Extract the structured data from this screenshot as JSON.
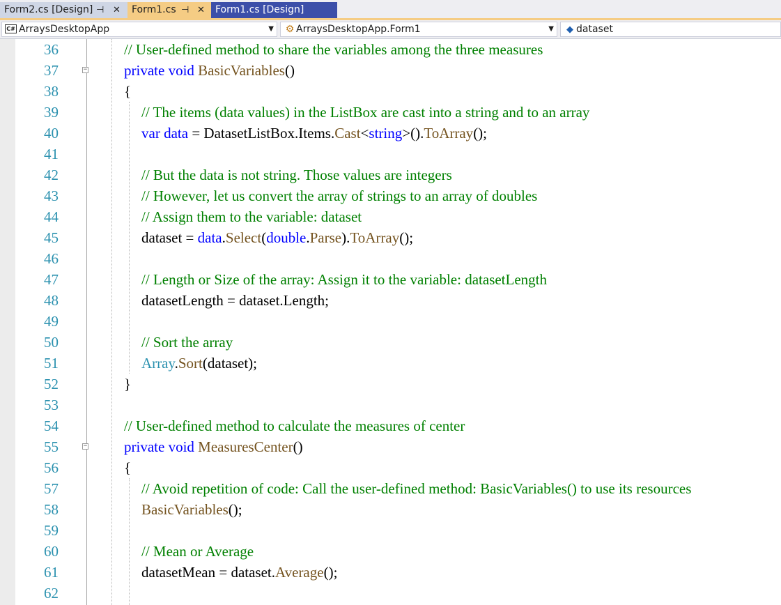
{
  "tabs": [
    {
      "label": "Form2.cs [Design]",
      "pinned": true,
      "closable": true
    },
    {
      "label": "Form1.cs",
      "pinned": true,
      "closable": true,
      "active": true
    },
    {
      "label": "Form1.cs [Design]"
    }
  ],
  "nav": {
    "project": "ArraysDesktopApp",
    "class": "ArraysDesktopApp.Form1",
    "member": "dataset",
    "project_icon": "csharp-icon",
    "class_icon": "class-icon",
    "member_icon": "field-icon"
  },
  "colors": {
    "comment": "#008000",
    "keyword": "#0000ff",
    "method": "#74531f",
    "type": "#2b91af",
    "line_number": "#2b91af",
    "active_tab": "#f5cc84"
  },
  "lines": [
    {
      "num": "36",
      "indent": 1,
      "tokens": [
        {
          "t": "// User-defined method to share the variables among the three measures",
          "c": "cm"
        }
      ]
    },
    {
      "num": "37",
      "indent": 1,
      "tokens": [
        {
          "t": "private",
          "c": "kw"
        },
        {
          "t": " ",
          "c": "pl"
        },
        {
          "t": "void",
          "c": "kw"
        },
        {
          "t": " ",
          "c": "pl"
        },
        {
          "t": "BasicVariables",
          "c": "mt"
        },
        {
          "t": "()",
          "c": "pl"
        }
      ]
    },
    {
      "num": "38",
      "indent": 1,
      "tokens": [
        {
          "t": "{",
          "c": "pl"
        }
      ]
    },
    {
      "num": "39",
      "indent": 2,
      "tokens": [
        {
          "t": "// The items (data values) in the ListBox are cast into a string and to an array",
          "c": "cm"
        }
      ]
    },
    {
      "num": "40",
      "indent": 2,
      "tokens": [
        {
          "t": "var",
          "c": "kw"
        },
        {
          "t": " ",
          "c": "pl"
        },
        {
          "t": "data",
          "c": "kw"
        },
        {
          "t": " = DatasetListBox.Items.",
          "c": "pl"
        },
        {
          "t": "Cast",
          "c": "mt"
        },
        {
          "t": "<",
          "c": "pl"
        },
        {
          "t": "string",
          "c": "kw"
        },
        {
          "t": ">().",
          "c": "pl"
        },
        {
          "t": "ToArray",
          "c": "mt"
        },
        {
          "t": "();",
          "c": "pl"
        }
      ]
    },
    {
      "num": "41",
      "indent": 2,
      "tokens": []
    },
    {
      "num": "42",
      "indent": 2,
      "tokens": [
        {
          "t": "// But the data is not string. Those values are integers",
          "c": "cm"
        }
      ]
    },
    {
      "num": "43",
      "indent": 2,
      "tokens": [
        {
          "t": "// However, let us convert the array of strings to an array of doubles",
          "c": "cm"
        }
      ]
    },
    {
      "num": "44",
      "indent": 2,
      "tokens": [
        {
          "t": "// Assign them to the variable: dataset",
          "c": "cm"
        }
      ]
    },
    {
      "num": "45",
      "indent": 2,
      "tokens": [
        {
          "t": "dataset = ",
          "c": "pl"
        },
        {
          "t": "data",
          "c": "kw"
        },
        {
          "t": ".",
          "c": "pl"
        },
        {
          "t": "Select",
          "c": "mt"
        },
        {
          "t": "(",
          "c": "pl"
        },
        {
          "t": "double",
          "c": "kw"
        },
        {
          "t": ".",
          "c": "pl"
        },
        {
          "t": "Parse",
          "c": "mt"
        },
        {
          "t": ").",
          "c": "pl"
        },
        {
          "t": "ToArray",
          "c": "mt"
        },
        {
          "t": "();",
          "c": "pl"
        }
      ]
    },
    {
      "num": "46",
      "indent": 2,
      "tokens": []
    },
    {
      "num": "47",
      "indent": 2,
      "tokens": [
        {
          "t": "// Length or Size of the array: Assign it to the variable: datasetLength",
          "c": "cm"
        }
      ]
    },
    {
      "num": "48",
      "indent": 2,
      "tokens": [
        {
          "t": "datasetLength = dataset.Length;",
          "c": "pl"
        }
      ]
    },
    {
      "num": "49",
      "indent": 2,
      "tokens": []
    },
    {
      "num": "50",
      "indent": 2,
      "tokens": [
        {
          "t": "// Sort the array",
          "c": "cm"
        }
      ]
    },
    {
      "num": "51",
      "indent": 2,
      "tokens": [
        {
          "t": "Array",
          "c": "ty"
        },
        {
          "t": ".",
          "c": "pl"
        },
        {
          "t": "Sort",
          "c": "mt"
        },
        {
          "t": "(dataset);",
          "c": "pl"
        }
      ]
    },
    {
      "num": "52",
      "indent": 1,
      "tokens": [
        {
          "t": "}",
          "c": "pl"
        }
      ]
    },
    {
      "num": "53",
      "indent": 1,
      "tokens": []
    },
    {
      "num": "54",
      "indent": 1,
      "tokens": [
        {
          "t": "// User-defined method to calculate the measures of center",
          "c": "cm"
        }
      ]
    },
    {
      "num": "55",
      "indent": 1,
      "tokens": [
        {
          "t": "private",
          "c": "kw"
        },
        {
          "t": " ",
          "c": "pl"
        },
        {
          "t": "void",
          "c": "kw"
        },
        {
          "t": " ",
          "c": "pl"
        },
        {
          "t": "MeasuresCenter",
          "c": "mt"
        },
        {
          "t": "()",
          "c": "pl"
        }
      ]
    },
    {
      "num": "56",
      "indent": 1,
      "tokens": [
        {
          "t": "{",
          "c": "pl"
        }
      ]
    },
    {
      "num": "57",
      "indent": 2,
      "tokens": [
        {
          "t": "// Avoid repetition of code: Call the user-defined method: BasicVariables() to use its resources",
          "c": "cm"
        }
      ]
    },
    {
      "num": "58",
      "indent": 2,
      "tokens": [
        {
          "t": "BasicVariables",
          "c": "mt"
        },
        {
          "t": "();",
          "c": "pl"
        }
      ]
    },
    {
      "num": "59",
      "indent": 2,
      "tokens": []
    },
    {
      "num": "60",
      "indent": 2,
      "tokens": [
        {
          "t": "// Mean or Average",
          "c": "cm"
        }
      ]
    },
    {
      "num": "61",
      "indent": 2,
      "tokens": [
        {
          "t": "datasetMean = dataset.",
          "c": "pl"
        },
        {
          "t": "Average",
          "c": "mt"
        },
        {
          "t": "();",
          "c": "pl"
        }
      ]
    },
    {
      "num": "62",
      "indent": 2,
      "tokens": []
    }
  ]
}
